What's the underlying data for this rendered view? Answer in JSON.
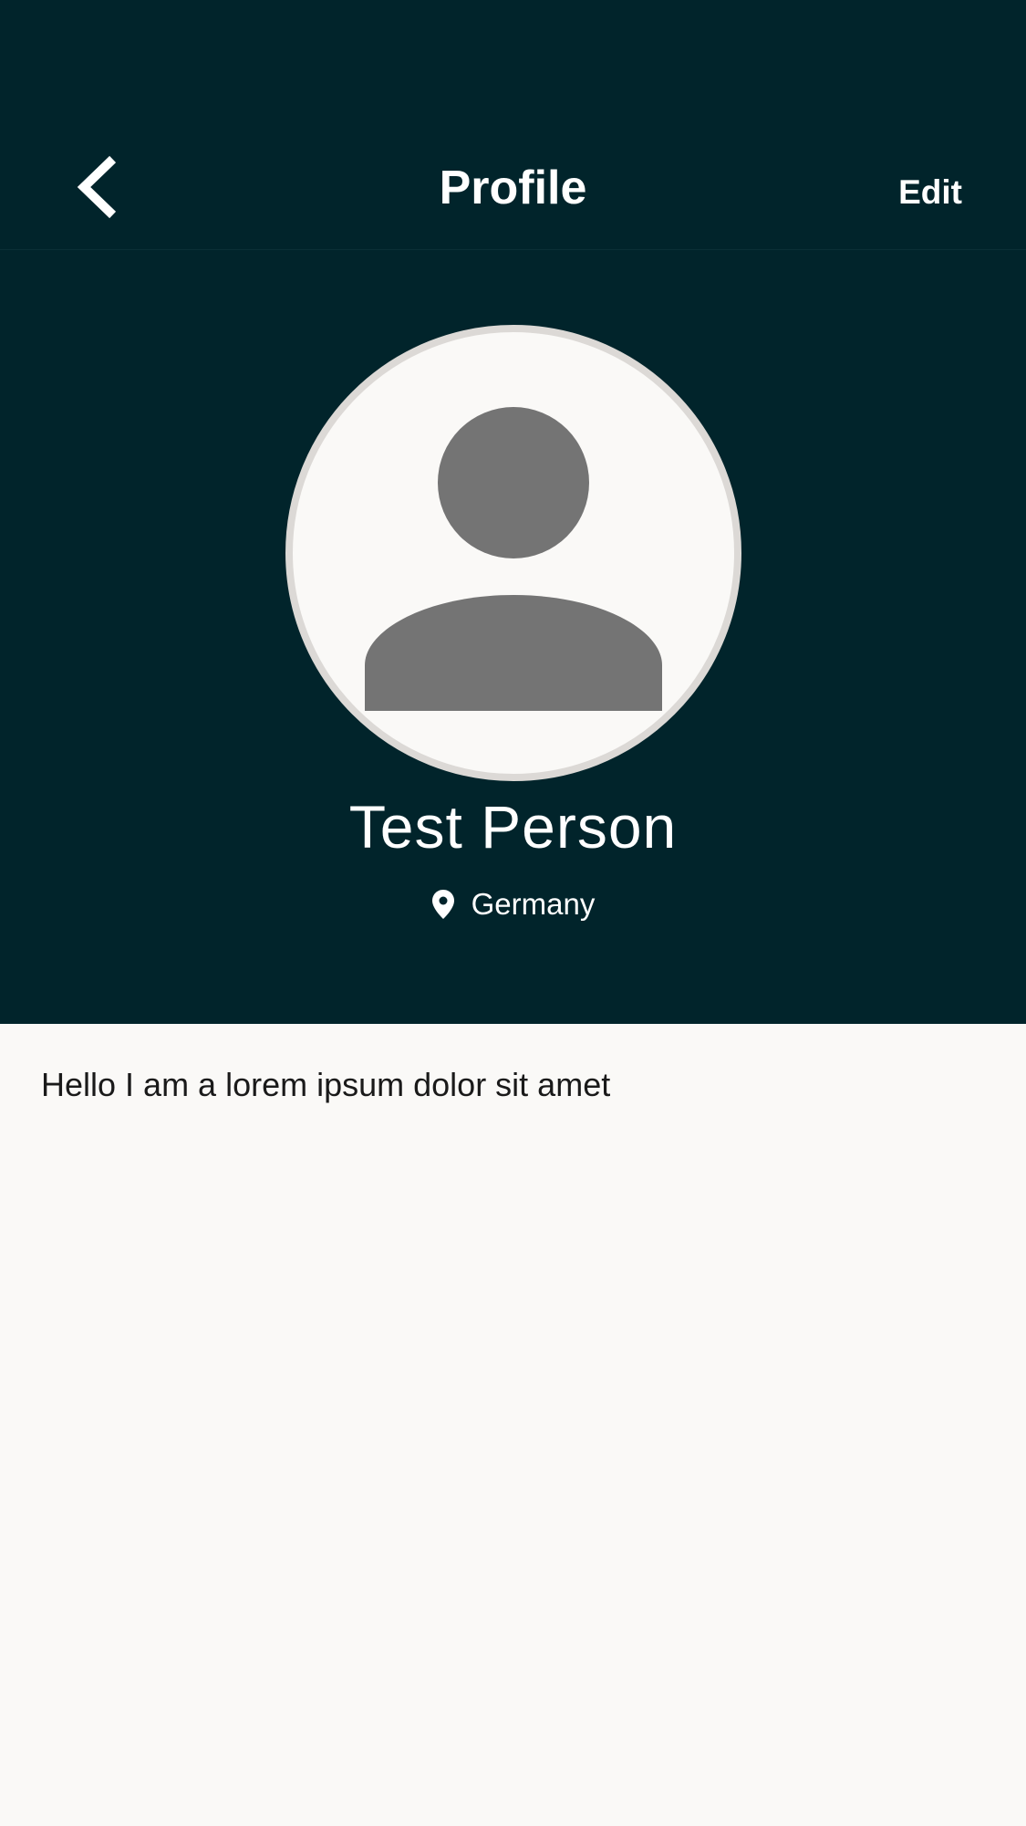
{
  "navbar": {
    "title": "Profile",
    "edit_label": "Edit"
  },
  "profile": {
    "name": "Test Person",
    "location": "Germany",
    "bio": "Hello I am a lorem ipsum dolor sit amet"
  },
  "icons": {
    "back": "chevron-left-icon",
    "avatar": "person-placeholder-icon",
    "location": "map-pin-icon"
  },
  "colors": {
    "header_background": "#01242b",
    "page_background": "#faf9f7",
    "avatar_silhouette": "#747474",
    "avatar_border": "#dcd9d6"
  }
}
